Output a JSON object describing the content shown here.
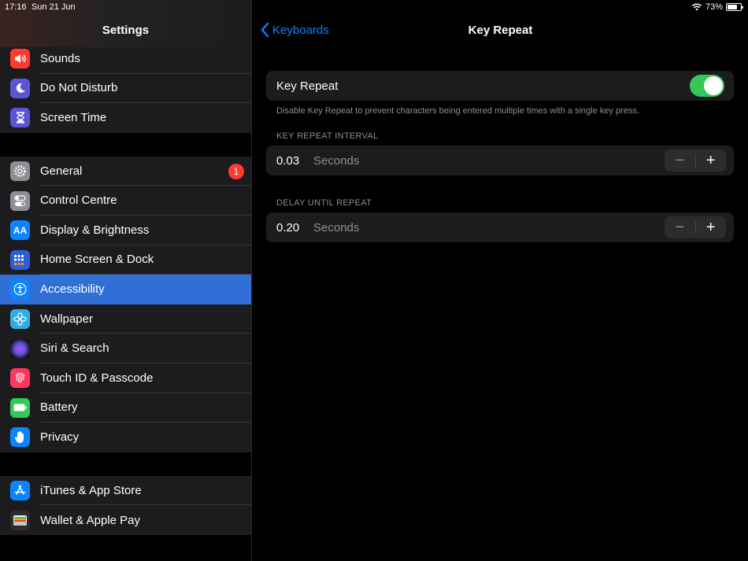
{
  "status": {
    "time": "17:16",
    "date": "Sun 21 Jun",
    "battery": "73%"
  },
  "sidebar": {
    "title": "Settings",
    "group1": [
      {
        "label": "Sounds",
        "icon": "speaker-icon",
        "color": "#ff3b30"
      },
      {
        "label": "Do Not Disturb",
        "icon": "moon-icon",
        "color": "#5856d6"
      },
      {
        "label": "Screen Time",
        "icon": "hourglass-icon",
        "color": "#5856d6"
      }
    ],
    "group2": [
      {
        "label": "General",
        "icon": "gear-icon",
        "color": "#8e8e93",
        "badge": "1"
      },
      {
        "label": "Control Centre",
        "icon": "switches-icon",
        "color": "#8e8e93"
      },
      {
        "label": "Display & Brightness",
        "icon": "aa-icon",
        "color": "#0a84ff"
      },
      {
        "label": "Home Screen & Dock",
        "icon": "grid-icon",
        "color": "#2c5fd6"
      },
      {
        "label": "Accessibility",
        "icon": "accessibility-icon",
        "color": "#0a84ff",
        "selected": true
      },
      {
        "label": "Wallpaper",
        "icon": "flower-icon",
        "color": "#32ade6"
      },
      {
        "label": "Siri & Search",
        "icon": "siri-icon",
        "color": "#222"
      },
      {
        "label": "Touch ID & Passcode",
        "icon": "fingerprint-icon",
        "color": "#ff375f"
      },
      {
        "label": "Battery",
        "icon": "battery-icon",
        "color": "#34c759"
      },
      {
        "label": "Privacy",
        "icon": "hand-icon",
        "color": "#0a84ff"
      }
    ],
    "group3": [
      {
        "label": "iTunes & App Store",
        "icon": "appstore-icon",
        "color": "#0a84ff"
      },
      {
        "label": "Wallet & Apple Pay",
        "icon": "wallet-icon",
        "color": "#2c2c2e"
      }
    ],
    "badge": "1"
  },
  "detail": {
    "back_label": "Keyboards",
    "title": "Key Repeat",
    "toggle": {
      "label": "Key Repeat",
      "on": true
    },
    "footnote": "Disable Key Repeat to prevent characters being entered multiple times with a single key press.",
    "interval": {
      "header": "KEY REPEAT INTERVAL",
      "value": "0.03",
      "unit": "Seconds"
    },
    "delay": {
      "header": "DELAY UNTIL REPEAT",
      "value": "0.20",
      "unit": "Seconds"
    },
    "stepper": {
      "minus": "−",
      "plus": "+"
    }
  }
}
